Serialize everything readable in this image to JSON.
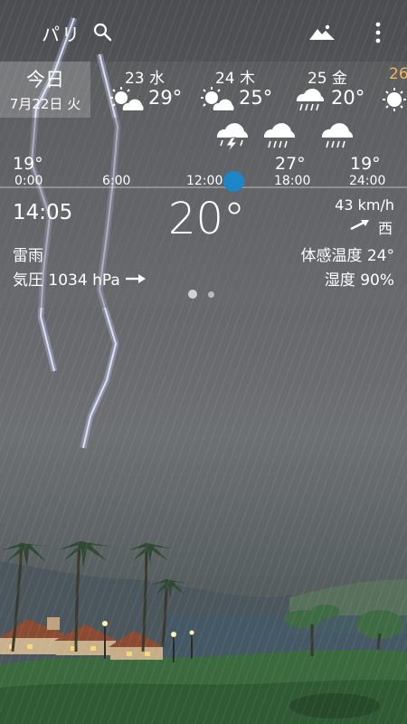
{
  "header": {
    "city": "パリ",
    "search_icon": "search-icon",
    "landscape_icon": "landscape-icon",
    "menu_icon": "more-vert-icon"
  },
  "daily": {
    "today": {
      "label": "今日",
      "date": "7月22日 火"
    },
    "days": [
      {
        "label": "23 水",
        "temp": "29°",
        "icon": "sun-cloud-icon"
      },
      {
        "label": "24 木",
        "temp": "25°",
        "icon": "sun-cloud-icon"
      },
      {
        "label": "25 金",
        "temp": "20°",
        "icon": "rain-cloud-icon"
      },
      {
        "label": "26",
        "temp": "",
        "icon": "sun-icon"
      }
    ]
  },
  "hourly": {
    "temps": [
      {
        "value": "19°",
        "time": "0:00"
      },
      {
        "value": "",
        "time": "6:00"
      },
      {
        "value": "",
        "time": "12:00"
      },
      {
        "value": "27°",
        "time": "18:00"
      },
      {
        "value": "19°",
        "time": "24:00"
      }
    ],
    "icons": [
      "thunderstorm-icon",
      "rain-icon",
      "rain-icon"
    ]
  },
  "current": {
    "time": "14:05",
    "temperature": "20°",
    "wind_speed": "43 km/h",
    "wind_direction": "西",
    "condition": "雷雨",
    "feels_like": "体感温度 24°",
    "pressure": "気圧 1034 hPa",
    "humidity": "湿度 90%"
  },
  "colors": {
    "now_dot": "#1b86c8",
    "accent_partial_day": "#f1b65b"
  }
}
